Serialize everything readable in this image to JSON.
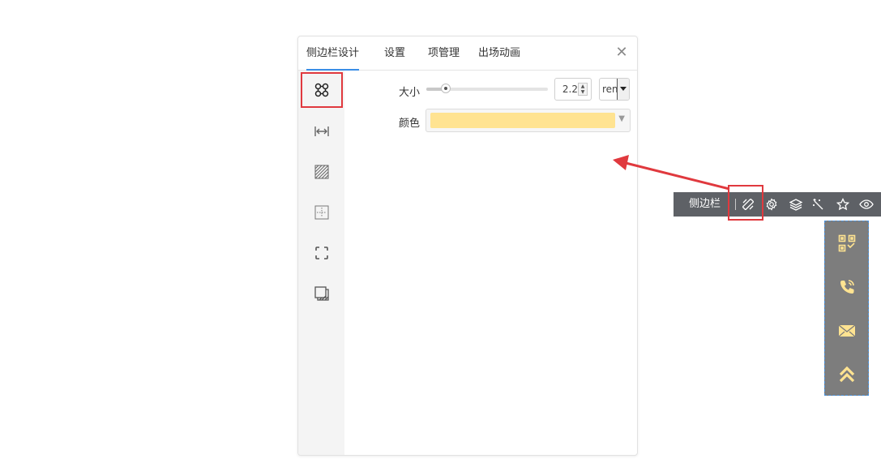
{
  "panel": {
    "tabs": [
      {
        "label": "侧边栏设计",
        "active": true
      },
      {
        "label": "设置",
        "active": false
      },
      {
        "label": "项管理",
        "active": false
      },
      {
        "label": "出场动画",
        "active": false
      }
    ],
    "close_icon": "close-icon",
    "side_icons": [
      "layout-icon",
      "width-icon",
      "background-icon",
      "padding-icon",
      "border-icon",
      "shadow-icon"
    ],
    "size": {
      "label": "大小",
      "value": "2.2",
      "unit": "rem",
      "slider_fraction": 0.16
    },
    "color": {
      "label": "颜色",
      "value": "#ffe391"
    }
  },
  "toolbar": {
    "label": "侧边栏",
    "icons": [
      "design-icon",
      "settings-icon",
      "layers-icon",
      "animation-icon",
      "star-icon",
      "eye-icon"
    ]
  },
  "preview": {
    "background": "#7d7d7d",
    "icon_color": "#ffe391",
    "items": [
      "qrcode-icon",
      "phone-icon",
      "mail-icon",
      "back-to-top-icon"
    ]
  },
  "colors": {
    "accent": "#3a8ee6",
    "highlight": "#e0393e",
    "toolbar_bg": "#5e6166"
  }
}
